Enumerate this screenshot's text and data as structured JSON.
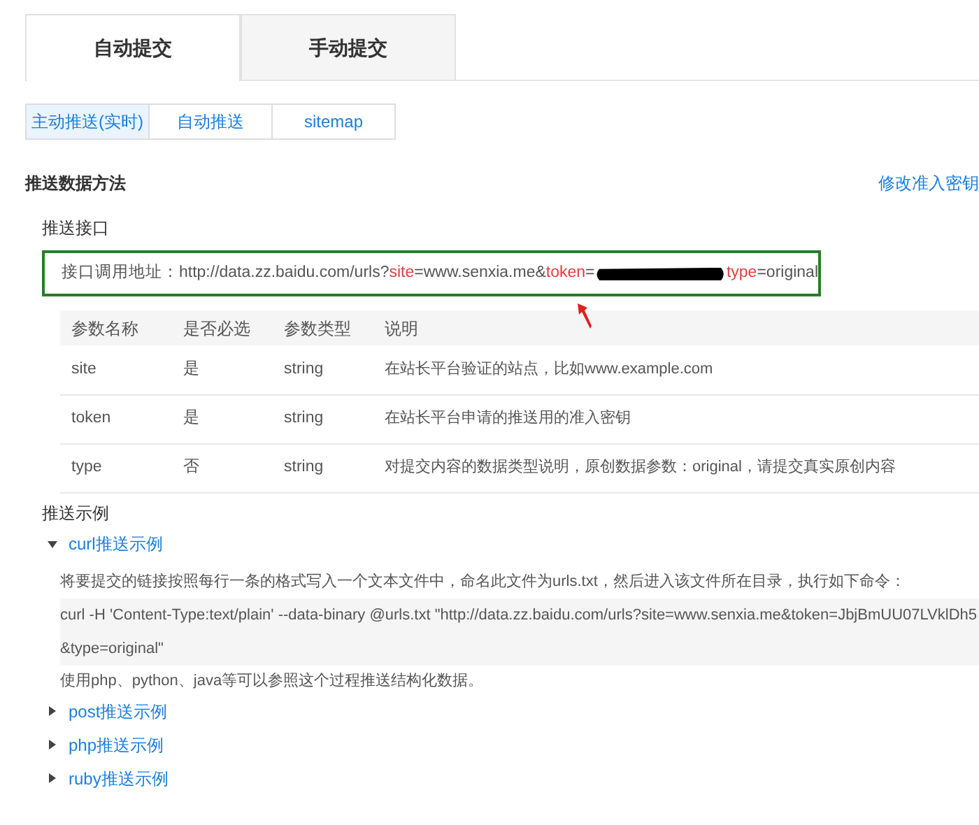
{
  "tabs": [
    {
      "label": "自动提交",
      "selected": true
    },
    {
      "label": "手动提交",
      "selected": false
    }
  ],
  "subtabs": [
    {
      "label": "主动推送(实时)",
      "selected": true
    },
    {
      "label": "自动推送",
      "selected": false
    },
    {
      "label": "sitemap",
      "selected": false
    }
  ],
  "section_title": "推送数据方法",
  "section_link": "修改准入密钥",
  "api_heading": "推送接口",
  "api_address": {
    "label": "接口调用地址：",
    "parts": [
      {
        "kind": "text",
        "text": "http://data.zz.baidu.com/urls?"
      },
      {
        "kind": "key",
        "text": "site"
      },
      {
        "kind": "text",
        "text": "=www.senxia.me&"
      },
      {
        "kind": "key",
        "text": "token"
      },
      {
        "kind": "text",
        "text": "="
      },
      {
        "kind": "redacted"
      },
      {
        "kind": "key",
        "text": "type"
      },
      {
        "kind": "text",
        "text": "=original"
      }
    ]
  },
  "table": {
    "columns": [
      "参数名称",
      "是否必选",
      "参数类型",
      "说明"
    ],
    "rows": [
      [
        "site",
        "是",
        "string",
        "在站长平台验证的站点，比如www.example.com"
      ],
      [
        "token",
        "是",
        "string",
        "在站长平台申请的推送用的准入密钥"
      ],
      [
        "type",
        "否",
        "string",
        "对提交内容的数据类型说明，原创数据参数：original，请提交真实原创内容"
      ]
    ]
  },
  "examples_heading": "推送示例",
  "examples": [
    {
      "label": "curl推送示例",
      "expanded": true,
      "intro": "将要提交的链接按照每行一条的格式写入一个文本文件中，命名此文件为urls.txt，然后进入该文件所在目录，执行如下命令：",
      "command": "curl -H 'Content-Type:text/plain' --data-binary @urls.txt \"http://data.zz.baidu.com/urls?site=www.senxia.me&token=JbjBmUU07LVklDh5&type=original\"",
      "note": "使用php、python、java等可以参照这个过程推送结构化数据。"
    },
    {
      "label": "post推送示例",
      "expanded": false
    },
    {
      "label": "php推送示例",
      "expanded": false
    },
    {
      "label": "ruby推送示例",
      "expanded": false
    }
  ]
}
